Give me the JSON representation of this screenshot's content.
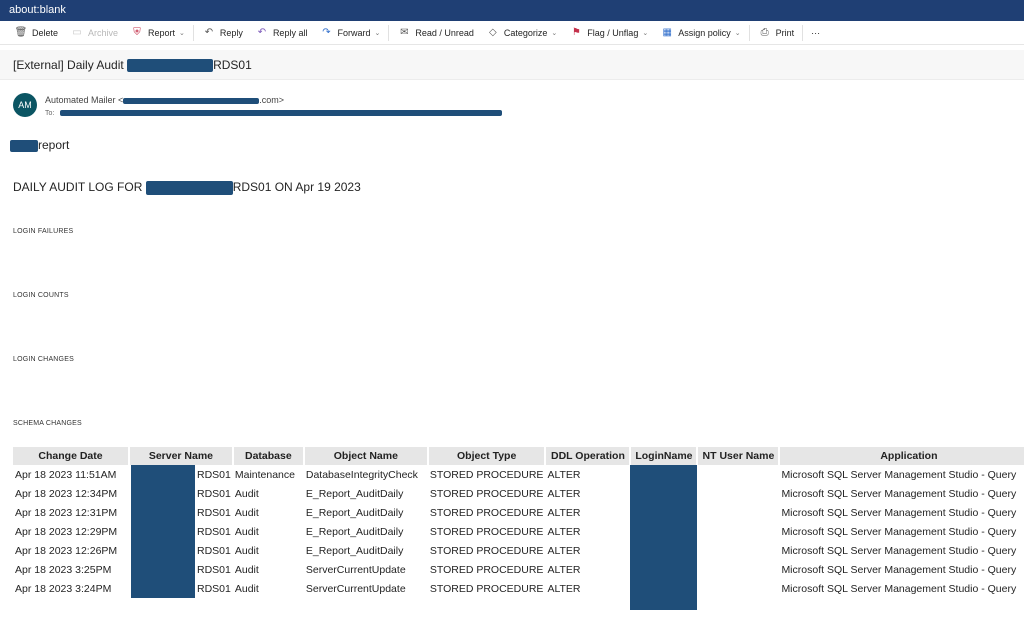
{
  "window": {
    "address": "about:blank"
  },
  "toolbar": {
    "items": [
      {
        "id": "delete",
        "label": "Delete",
        "icon": "trash-icon",
        "glyph": "🗑",
        "disabled": false,
        "chevron": false
      },
      {
        "id": "archive",
        "label": "Archive",
        "icon": "archive-icon",
        "glyph": "▭",
        "disabled": true,
        "chevron": false
      },
      {
        "id": "report",
        "label": "Report",
        "icon": "shield-icon",
        "glyph": "⛨",
        "disabled": false,
        "chevron": true,
        "accent": "red"
      },
      {
        "id": "reply",
        "label": "Reply",
        "icon": "reply-icon",
        "glyph": "↶",
        "disabled": false,
        "chevron": false
      },
      {
        "id": "reply-all",
        "label": "Reply all",
        "icon": "reply-all-icon",
        "glyph": "↶",
        "disabled": false,
        "chevron": false,
        "accent": "purple"
      },
      {
        "id": "forward",
        "label": "Forward",
        "icon": "forward-icon",
        "glyph": "↷",
        "disabled": false,
        "chevron": true,
        "accent": "blue"
      },
      {
        "id": "read-unread",
        "label": "Read / Unread",
        "icon": "envelope-icon",
        "glyph": "✉",
        "disabled": false,
        "chevron": false
      },
      {
        "id": "categorize",
        "label": "Categorize",
        "icon": "tag-icon",
        "glyph": "◇",
        "disabled": false,
        "chevron": true
      },
      {
        "id": "flag",
        "label": "Flag / Unflag",
        "icon": "flag-icon",
        "glyph": "⚑",
        "disabled": false,
        "chevron": true,
        "accent": "red"
      },
      {
        "id": "assign-policy",
        "label": "Assign policy",
        "icon": "policy-icon",
        "glyph": "▦",
        "disabled": false,
        "chevron": true,
        "accent": "blue"
      },
      {
        "id": "print",
        "label": "Print",
        "icon": "printer-icon",
        "glyph": "⎙",
        "disabled": false,
        "chevron": false
      },
      {
        "id": "more",
        "label": "···",
        "icon": "more-icon",
        "glyph": "",
        "disabled": false,
        "chevron": false
      }
    ]
  },
  "message": {
    "subject_prefix": "[External] Daily Audit ",
    "subject_suffix": "RDS01",
    "sender_initials": "AM",
    "sender_name": "Automated Mailer <",
    "sender_email_suffix": ".com>",
    "to_label": "To:"
  },
  "body": {
    "intro_suffix": "report",
    "heading_prefix": "DAILY AUDIT LOG FOR ",
    "heading_suffix": "RDS01 ON Apr 19 2023",
    "sections": [
      "LOGIN FAILURES",
      "LOGIN COUNTS",
      "LOGIN CHANGES",
      "SCHEMA CHANGES"
    ]
  },
  "table": {
    "columns": [
      "Change Date",
      "Server Name",
      "Database",
      "Object Name",
      "Object Type",
      "DDL Operation",
      "LoginName",
      "NT User Name",
      "Application"
    ],
    "rows": [
      [
        "Apr 18 2023 11:51AM",
        "RDS01",
        "Maintenance",
        "DatabaseIntegrityCheck",
        "STORED PROCEDURE",
        "ALTER",
        "",
        "",
        "Microsoft SQL Server Management Studio - Query"
      ],
      [
        "Apr 18 2023 12:34PM",
        "RDS01",
        "Audit",
        "E_Report_AuditDaily",
        "STORED PROCEDURE",
        "ALTER",
        "",
        "",
        "Microsoft SQL Server Management Studio - Query"
      ],
      [
        "Apr 18 2023 12:31PM",
        "RDS01",
        "Audit",
        "E_Report_AuditDaily",
        "STORED PROCEDURE",
        "ALTER",
        "",
        "",
        "Microsoft SQL Server Management Studio - Query"
      ],
      [
        "Apr 18 2023 12:29PM",
        "RDS01",
        "Audit",
        "E_Report_AuditDaily",
        "STORED PROCEDURE",
        "ALTER",
        "",
        "",
        "Microsoft SQL Server Management Studio - Query"
      ],
      [
        "Apr 18 2023 12:26PM",
        "RDS01",
        "Audit",
        "E_Report_AuditDaily",
        "STORED PROCEDURE",
        "ALTER",
        "",
        "",
        "Microsoft SQL Server Management Studio - Query"
      ],
      [
        "Apr 18 2023 3:25PM",
        "RDS01",
        "Audit",
        "ServerCurrentUpdate",
        "STORED PROCEDURE",
        "ALTER",
        "",
        "",
        "Microsoft SQL Server Management Studio - Query"
      ],
      [
        "Apr 18 2023 3:24PM",
        "RDS01",
        "Audit",
        "ServerCurrentUpdate",
        "STORED PROCEDURE",
        "ALTER",
        "",
        "",
        "Microsoft SQL Server Management Studio - Query"
      ]
    ]
  },
  "colors": {
    "titlebar": "#1f3f74",
    "redaction": "#1f4e79",
    "avatar": "#0b5563",
    "table_header": "#e6e6e6"
  }
}
